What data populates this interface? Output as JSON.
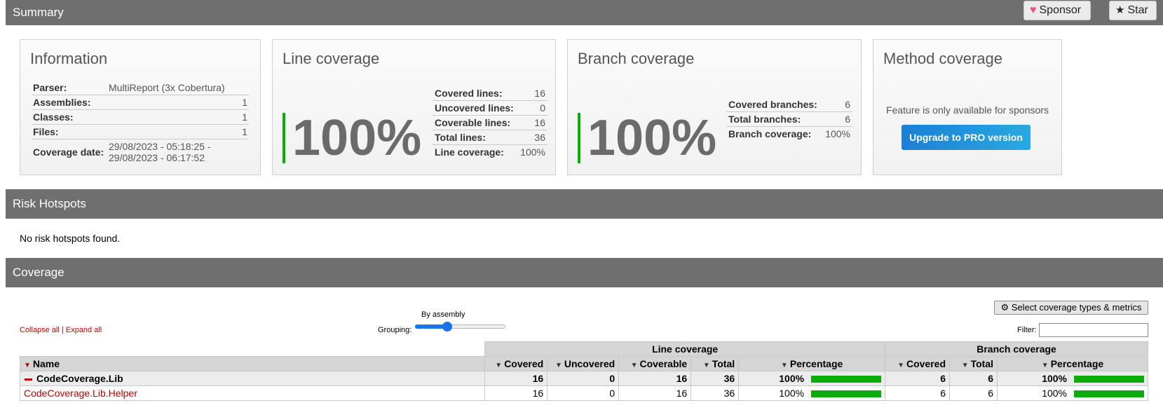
{
  "header": {
    "title": "Summary",
    "sponsor_label": "Sponsor",
    "star_label": "Star"
  },
  "information": {
    "title": "Information",
    "rows": [
      {
        "key": "Parser:",
        "value": "MultiReport (3x Cobertura)"
      },
      {
        "key": "Assemblies:",
        "value": "1"
      },
      {
        "key": "Classes:",
        "value": "1"
      },
      {
        "key": "Files:",
        "value": "1"
      },
      {
        "key": "Coverage date:",
        "value": "29/08/2023 - 05:18:25 - 29/08/2023 - 06:17:52"
      }
    ]
  },
  "line_coverage": {
    "title": "Line coverage",
    "percent": "100%",
    "bar_color": "#0aad0a",
    "rows": [
      {
        "key": "Covered lines:",
        "value": "16"
      },
      {
        "key": "Uncovered lines:",
        "value": "0"
      },
      {
        "key": "Coverable lines:",
        "value": "16"
      },
      {
        "key": "Total lines:",
        "value": "36"
      },
      {
        "key": "Line coverage:",
        "value": "100%"
      }
    ]
  },
  "branch_coverage": {
    "title": "Branch coverage",
    "percent": "100%",
    "rows": [
      {
        "key": "Covered branches:",
        "value": "6"
      },
      {
        "key": "Total branches:",
        "value": "6"
      },
      {
        "key": "Branch coverage:",
        "value": "100%"
      }
    ]
  },
  "method_coverage": {
    "title": "Method coverage",
    "message": "Feature is only available for sponsors",
    "upgrade_label": "Upgrade to PRO version"
  },
  "risk": {
    "title": "Risk Hotspots",
    "message": "No risk hotspots found."
  },
  "coverage": {
    "title": "Coverage",
    "select_label": "Select coverage types & metrics",
    "collapse_label": "Collapse all",
    "separator": "|",
    "expand_label": "Expand all",
    "grouping_label": "Grouping:",
    "grouping_value": "By assembly",
    "grouping_level": 0.33,
    "filter_label": "Filter:",
    "filter_value": "",
    "groups": {
      "line": "Line coverage",
      "branch": "Branch coverage"
    },
    "columns": {
      "name": "Name",
      "covered": "Covered",
      "uncovered": "Uncovered",
      "coverable": "Coverable",
      "total": "Total",
      "percentage": "Percentage",
      "b_covered": "Covered",
      "b_total": "Total",
      "b_percentage": "Percentage"
    },
    "rows": [
      {
        "name": "CodeCoverage.Lib",
        "covered": "16",
        "uncovered": "0",
        "coverable": "16",
        "total": "36",
        "line_pct": "100%",
        "b_covered": "6",
        "b_total": "6",
        "branch_pct": "100%"
      },
      {
        "name": "CodeCoverage.Lib.Helper",
        "covered": "16",
        "uncovered": "0",
        "coverable": "16",
        "total": "36",
        "line_pct": "100%",
        "b_covered": "6",
        "b_total": "6",
        "branch_pct": "100%"
      }
    ]
  }
}
